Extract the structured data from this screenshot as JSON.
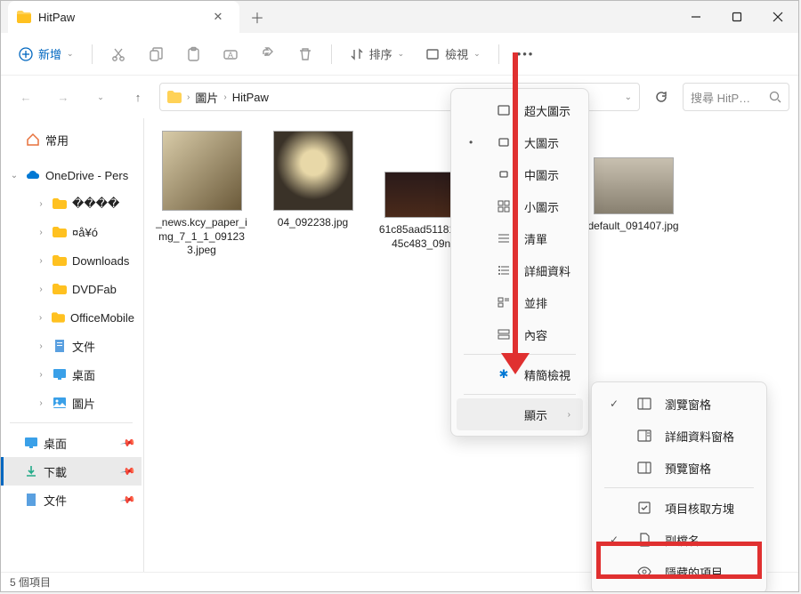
{
  "tab_title": "HitPaw",
  "toolbar": {
    "new_label": "新增",
    "sort_label": "排序",
    "view_label": "檢視"
  },
  "breadcrumbs": {
    "b1": "圖片",
    "b2": "HitPaw"
  },
  "search_placeholder": "搜尋 HitP…",
  "sidebar": {
    "home": "常用",
    "onedrive": "OneDrive - Pers",
    "od1": "����",
    "od2": "¤å¥ó",
    "od3": "Downloads",
    "od4": "DVDFab",
    "od5": "OfficeMobile",
    "od6": "文件",
    "od7": "桌面",
    "od8": "圖片",
    "q1": "桌面",
    "q2": "下載",
    "q3": "文件"
  },
  "files": {
    "f1": "_news.kcy_paper_img_7_1_1_091233.jpeg",
    "f2": "04_092238.jpg",
    "f3": "61c85aad51181fec45c483_09ng",
    "f4": "default_091407.jpg"
  },
  "status": "5 個項目",
  "view_menu": {
    "xl": "超大圖示",
    "lg": "大圖示",
    "md": "中圖示",
    "sm": "小圖示",
    "list": "清單",
    "details": "詳細資料",
    "tiles": "並排",
    "content": "內容",
    "compact": "精簡檢視",
    "show": "顯示"
  },
  "show_menu": {
    "nav": "瀏覽窗格",
    "det": "詳細資料窗格",
    "prev": "預覽窗格",
    "chk": "項目核取方塊",
    "ext": "副檔名",
    "hidden": "隱藏的項目"
  }
}
